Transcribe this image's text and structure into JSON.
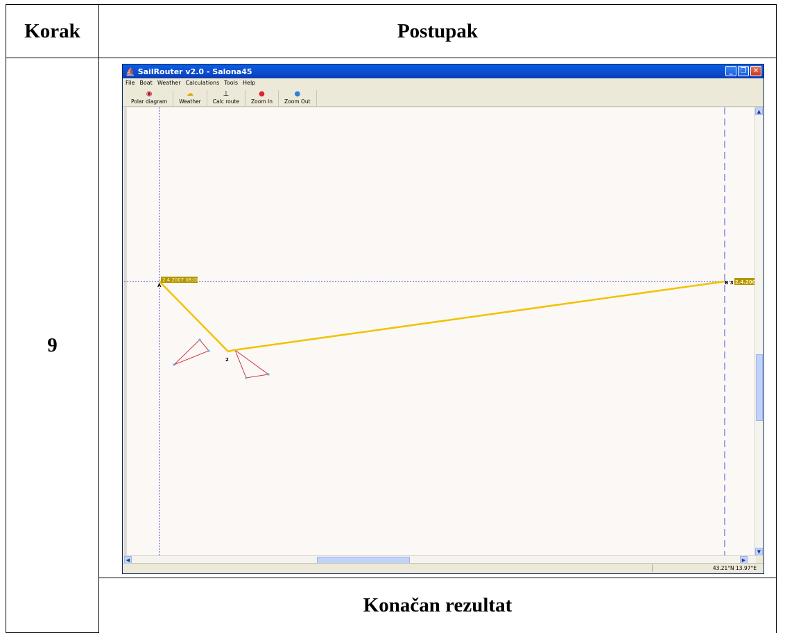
{
  "table": {
    "col_step": "Korak",
    "col_procedure": "Postupak",
    "step_number": "9",
    "result_header": "Konačan rezultat"
  },
  "window": {
    "title": "SailRouter v2.0 - Salona45",
    "menu": [
      "File",
      "Boat",
      "Weather",
      "Calculations",
      "Tools",
      "Help"
    ],
    "toolbar": [
      {
        "label": "Polar diagram",
        "icon": "polar-diagram-icon"
      },
      {
        "label": "Weather",
        "icon": "weather-icon"
      },
      {
        "label": "Calc route",
        "icon": "calc-route-icon"
      },
      {
        "label": "Zoom In",
        "icon": "zoom-in-icon"
      },
      {
        "label": "Zoom Out",
        "icon": "zoom-out-icon"
      }
    ],
    "status_coords": "43.21°N 13.97°E"
  },
  "map": {
    "start_label": "A",
    "start_date": "2.4.2007 08:00",
    "waypoint_label": "2",
    "end_label": "B 3",
    "end_date": "2.4.2007",
    "route_color": "#f2c200",
    "triangle_color": "#cc3344",
    "grid_color": "#4b4bd6"
  }
}
